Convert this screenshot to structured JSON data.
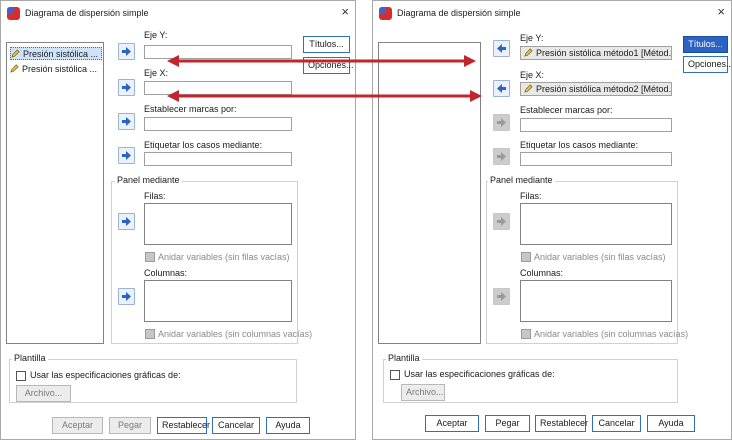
{
  "left_dialog": {
    "title": "Diagrama de dispersión simple",
    "close_glyph": "×",
    "variables": [
      "Presión sistólica ...",
      "Presión sistólica ..."
    ],
    "y_axis_label": "Eje Y:",
    "x_axis_label": "Eje X:",
    "set_markers_label": "Establecer marcas por:",
    "label_cases_label": "Etiquetar los casos mediante:",
    "panel_group": "Panel mediante",
    "rows_label": "Filas:",
    "nest_rows_label": "Anidar variables (sin filas vacías)",
    "columns_label": "Columnas:",
    "nest_columns_label": "Anidar variables (sin columnas vacías)",
    "titles_button": "Títulos...",
    "options_button": "Opciones...",
    "template_group": "Plantilla",
    "use_specs_label": "Usar las especificaciones gráficas de:",
    "file_button": "Archivo...",
    "buttons": {
      "ok": "Aceptar",
      "paste": "Pegar",
      "reset": "Restablecer",
      "cancel": "Cancelar",
      "help": "Ayuda"
    }
  },
  "right_dialog": {
    "title": "Diagrama de dispersión simple",
    "close_glyph": "×",
    "y_axis_label": "Eje Y:",
    "y_axis_value": "Presión sistólica método1 [Métod...",
    "x_axis_label": "Eje X:",
    "x_axis_value": "Presión sistólica método2 [Métod...",
    "set_markers_label": "Establecer marcas por:",
    "label_cases_label": "Etiquetar los casos mediante:",
    "panel_group": "Panel mediante",
    "rows_label": "Filas:",
    "nest_rows_label": "Anidar variables (sin filas vacías)",
    "columns_label": "Columnas:",
    "nest_columns_label": "Anidar variables (sin columnas vacías)",
    "titles_button": "Títulos...",
    "options_button": "Opciones...",
    "template_group": "Plantilla",
    "use_specs_label": "Usar las especificaciones gráficas de:",
    "file_button": "Archivo...",
    "buttons": {
      "ok": "Aceptar",
      "paste": "Pegar",
      "reset": "Restablecer",
      "cancel": "Cancelar",
      "help": "Ayuda"
    }
  },
  "colors": {
    "annotation_arrow": "#c0262d",
    "accent": "#2b63c5"
  }
}
